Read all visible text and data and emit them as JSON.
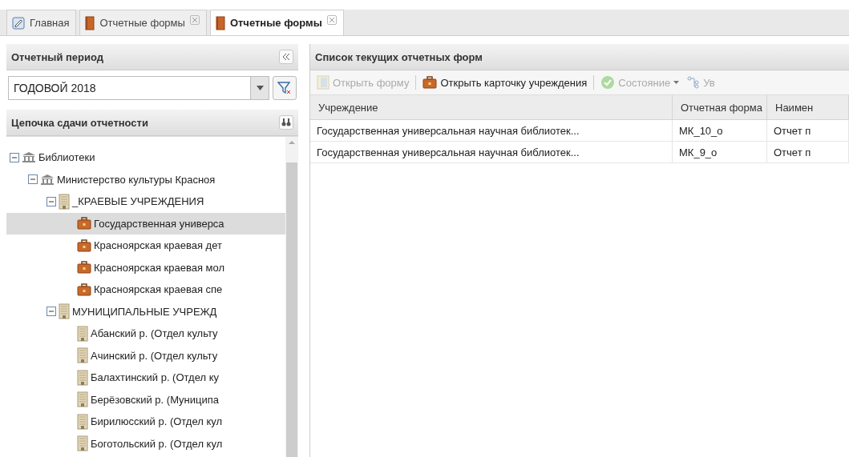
{
  "tabs": [
    {
      "label": "Главная",
      "kind": "home",
      "closable": false,
      "selected": false
    },
    {
      "label": "Отчетные формы",
      "kind": "book",
      "closable": true,
      "selected": false
    },
    {
      "label": "Отчетные формы",
      "kind": "book",
      "closable": true,
      "selected": true
    }
  ],
  "period_panel": {
    "title": "Отчетный период",
    "period_field": {
      "value": "ГОДОВОЙ 2018"
    }
  },
  "chain_panel": {
    "title": "Цепочка сдачи отчетности",
    "tree": [
      {
        "label": "Библиотеки",
        "kind": "institution",
        "expanded": true,
        "selected": false,
        "children": [
          {
            "label": "Министерство культуры Красноя",
            "kind": "institution",
            "expanded": true,
            "selected": false,
            "children": [
              {
                "label": "_КРАЕВЫЕ УЧРЕЖДЕНИЯ",
                "kind": "building",
                "expanded": true,
                "selected": false,
                "children": [
                  {
                    "label": "Государственная универса",
                    "kind": "briefcase",
                    "selected": true
                  },
                  {
                    "label": "Красноярская краевая дет",
                    "kind": "briefcase",
                    "selected": false
                  },
                  {
                    "label": "Красноярская краевая мол",
                    "kind": "briefcase",
                    "selected": false
                  },
                  {
                    "label": "Красноярская краевая спе",
                    "kind": "briefcase",
                    "selected": false
                  }
                ]
              },
              {
                "label": "МУНИЦИПАЛЬНЫЕ УЧРЕЖД",
                "kind": "building",
                "expanded": true,
                "selected": false,
                "children": [
                  {
                    "label": "Абанский р. (Отдел культу",
                    "kind": "building",
                    "selected": false
                  },
                  {
                    "label": "Ачинский р. (Отдел культу",
                    "kind": "building",
                    "selected": false
                  },
                  {
                    "label": "Балахтинский р. (Отдел ку",
                    "kind": "building",
                    "selected": false
                  },
                  {
                    "label": "Берёзовский р. (Муниципа",
                    "kind": "building",
                    "selected": false
                  },
                  {
                    "label": "Бирилюсский р. (Отдел кул",
                    "kind": "building",
                    "selected": false
                  },
                  {
                    "label": "Боготольский р. (Отдел кул",
                    "kind": "building",
                    "selected": false
                  }
                ]
              }
            ]
          }
        ]
      }
    ]
  },
  "forms_panel": {
    "title": "Список текущих отчетных форм",
    "toolbar": [
      {
        "label": "Открыть форму",
        "kind": "form",
        "disabled": true,
        "dropdown": false
      },
      {
        "label": "Открыть карточку учреждения",
        "kind": "briefcase",
        "disabled": false,
        "dropdown": false
      },
      {
        "label": "Состояние",
        "kind": "status",
        "disabled": true,
        "dropdown": true
      },
      {
        "label": "Ув",
        "kind": "tree",
        "disabled": true,
        "dropdown": false
      }
    ],
    "table": {
      "columns": [
        "Учреждение",
        "Отчетная форма",
        "Наимен"
      ],
      "rows": [
        [
          "Государственная универсальная научная библиотек...",
          "МК_10_о",
          "Отчет п"
        ],
        [
          "Государственная универсальная научная библиотек...",
          "МК_9_о",
          "Отчет п"
        ]
      ]
    }
  }
}
